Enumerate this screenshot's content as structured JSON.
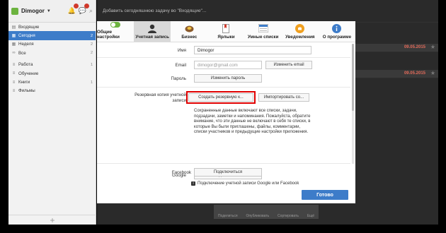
{
  "sidebar": {
    "user": "Dimogor",
    "items": [
      {
        "label": "Входящие",
        "count": "",
        "icon": "inbox-icon"
      },
      {
        "label": "Сегодня",
        "count": "2",
        "icon": "calendar-today-icon"
      },
      {
        "label": "Неделя",
        "count": "2",
        "icon": "calendar-week-icon"
      },
      {
        "label": "Все",
        "count": "2",
        "icon": "all-icon"
      },
      {
        "label": "Работа",
        "count": "1",
        "icon": "list-icon"
      },
      {
        "label": "Обучение",
        "count": "",
        "icon": "list-icon"
      },
      {
        "label": "Книги",
        "count": "1",
        "icon": "list-icon"
      },
      {
        "label": "Фильмы",
        "count": "",
        "icon": "list-icon"
      }
    ],
    "add_symbol": "+"
  },
  "background": {
    "add_task_placeholder": "Добавить сегодняшнюю задачу во \"Входящие\"...",
    "row_date": "09.05.2015",
    "toolbar": [
      "Поделиться",
      "Опубликовать",
      "Сортировать",
      "Ещё"
    ]
  },
  "dialog": {
    "tabs": [
      {
        "label": "Общие настройки",
        "icon": "toggle-icon"
      },
      {
        "label": "Учетная запись",
        "icon": "user-icon"
      },
      {
        "label": "Бизнес",
        "icon": "business-icon"
      },
      {
        "label": "Ярлыки",
        "icon": "bookmark-icon"
      },
      {
        "label": "Умные списки",
        "icon": "smart-list-icon"
      },
      {
        "label": "Уведомления",
        "icon": "bell-icon"
      },
      {
        "label": "О программе",
        "icon": "info-icon"
      }
    ],
    "name_label": "Имя",
    "name_value": "Dimogor",
    "email_label": "Email",
    "email_value": "dimogor@gmail.com",
    "change_email": "Изменить email",
    "password_label": "Пароль",
    "change_password": "Изменить пароль",
    "backup_label": "Резервная копия учетной записи",
    "create_backup": "Создать резервную к...",
    "import_button": "Импортировать со...",
    "backup_description": "Сохраненные данные включают все списки, задачи, подзадачи, заметки и напоминания. Пожалуйста, обратите внимание, что эти данные не включают в себя те списки, в которые Вы были приглашены, файлы, комментарии, списки участников и предыдущие настройки приложения.",
    "google_label": "Google",
    "google_connect": "Подключиться",
    "facebook_label": "Facebook",
    "facebook_connect": "Подключиться",
    "connect_note": "Подключение учетной записи Google или Facebook",
    "done": "Готово"
  }
}
